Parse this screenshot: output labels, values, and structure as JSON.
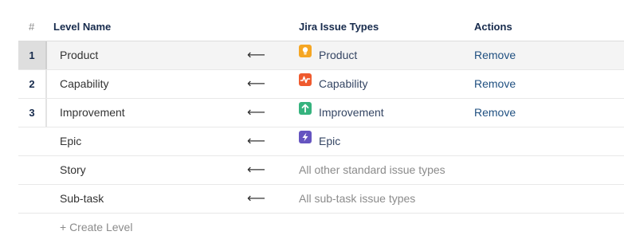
{
  "header": {
    "num": "#",
    "level_name": "Level Name",
    "issue_types": "Jira Issue Types",
    "actions": "Actions"
  },
  "rows": [
    {
      "num": "1",
      "name": "Product",
      "arrow": "⟵",
      "issue_type": "Product",
      "icon": "lightbulb-icon",
      "icon_color": "#f5a623",
      "action": "Remove"
    },
    {
      "num": "2",
      "name": "Capability",
      "arrow": "⟵",
      "issue_type": "Capability",
      "icon": "pulse-icon",
      "icon_color": "#ef5a2e",
      "action": "Remove"
    },
    {
      "num": "3",
      "name": "Improvement",
      "arrow": "⟵",
      "issue_type": "Improvement",
      "icon": "arrow-up-icon",
      "icon_color": "#36b37e",
      "action": "Remove"
    },
    {
      "num": "",
      "name": "Epic",
      "arrow": "⟵",
      "issue_type": "Epic",
      "icon": "lightning-icon",
      "icon_color": "#6554c0",
      "action": ""
    },
    {
      "num": "",
      "name": "Story",
      "arrow": "⟵",
      "issue_type": "All other standard issue types",
      "action": ""
    },
    {
      "num": "",
      "name": "Sub-task",
      "arrow": "⟵",
      "issue_type": "All sub-task issue types",
      "action": ""
    }
  ],
  "create_level": "+ Create Level"
}
